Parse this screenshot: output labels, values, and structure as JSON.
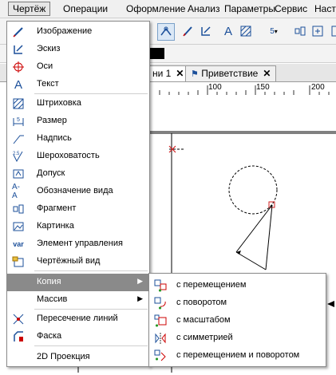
{
  "menubar": {
    "items": [
      "Чертёж",
      "Операции",
      "Оформление",
      "Анализ",
      "Параметры",
      "Сервис",
      "Настр"
    ]
  },
  "toolbar": {
    "dimension_badge": "5"
  },
  "tabs": [
    {
      "label": "ни 1"
    },
    {
      "label": "Приветствие"
    }
  ],
  "ruler": {
    "labels": [
      "100",
      "150",
      "200"
    ]
  },
  "menu": {
    "items": [
      {
        "label": "Изображение",
        "icon": "pen-icon"
      },
      {
        "label": "Эскиз",
        "icon": "sketch-icon"
      },
      {
        "label": "Оси",
        "icon": "axis-icon"
      },
      {
        "label": "Текст",
        "icon": "text-icon"
      },
      {
        "label": "Штриховка",
        "icon": "hatch-icon"
      },
      {
        "label": "Размер",
        "icon": "dimension-icon"
      },
      {
        "label": "Надпись",
        "icon": "leader-icon"
      },
      {
        "label": "Шероховатость",
        "icon": "roughness-icon"
      },
      {
        "label": "Допуск",
        "icon": "tolerance-icon"
      },
      {
        "label": "Обозначение вида",
        "icon": "view-mark-icon"
      },
      {
        "label": "Фрагмент",
        "icon": "fragment-icon"
      },
      {
        "label": "Картинка",
        "icon": "picture-icon"
      },
      {
        "label": "Элемент управления",
        "icon": "variable-icon"
      },
      {
        "label": "Чертёжный вид",
        "icon": "drawing-view-icon"
      },
      {
        "label": "Копия",
        "icon": "",
        "submenu": true
      },
      {
        "label": "Массив",
        "icon": "",
        "submenu": true
      },
      {
        "label": "Пересечение линий",
        "icon": "intersection-icon"
      },
      {
        "label": "Фаска",
        "icon": "chamfer-icon"
      },
      {
        "label": "2D Проекция",
        "icon": ""
      }
    ]
  },
  "submenu": {
    "items": [
      {
        "label": "с перемещением",
        "icon": "copy-move-icon"
      },
      {
        "label": "с поворотом",
        "icon": "copy-rotate-icon"
      },
      {
        "label": "с масштабом",
        "icon": "copy-scale-icon"
      },
      {
        "label": "с симметрией",
        "icon": "copy-mirror-icon"
      },
      {
        "label": "с перемещением и поворотом",
        "icon": "copy-move-rotate-icon"
      }
    ]
  },
  "colors": {
    "highlight": "#8a8a8a",
    "icon_blue": "#1b4f9a",
    "marker_red": "#d02020"
  }
}
